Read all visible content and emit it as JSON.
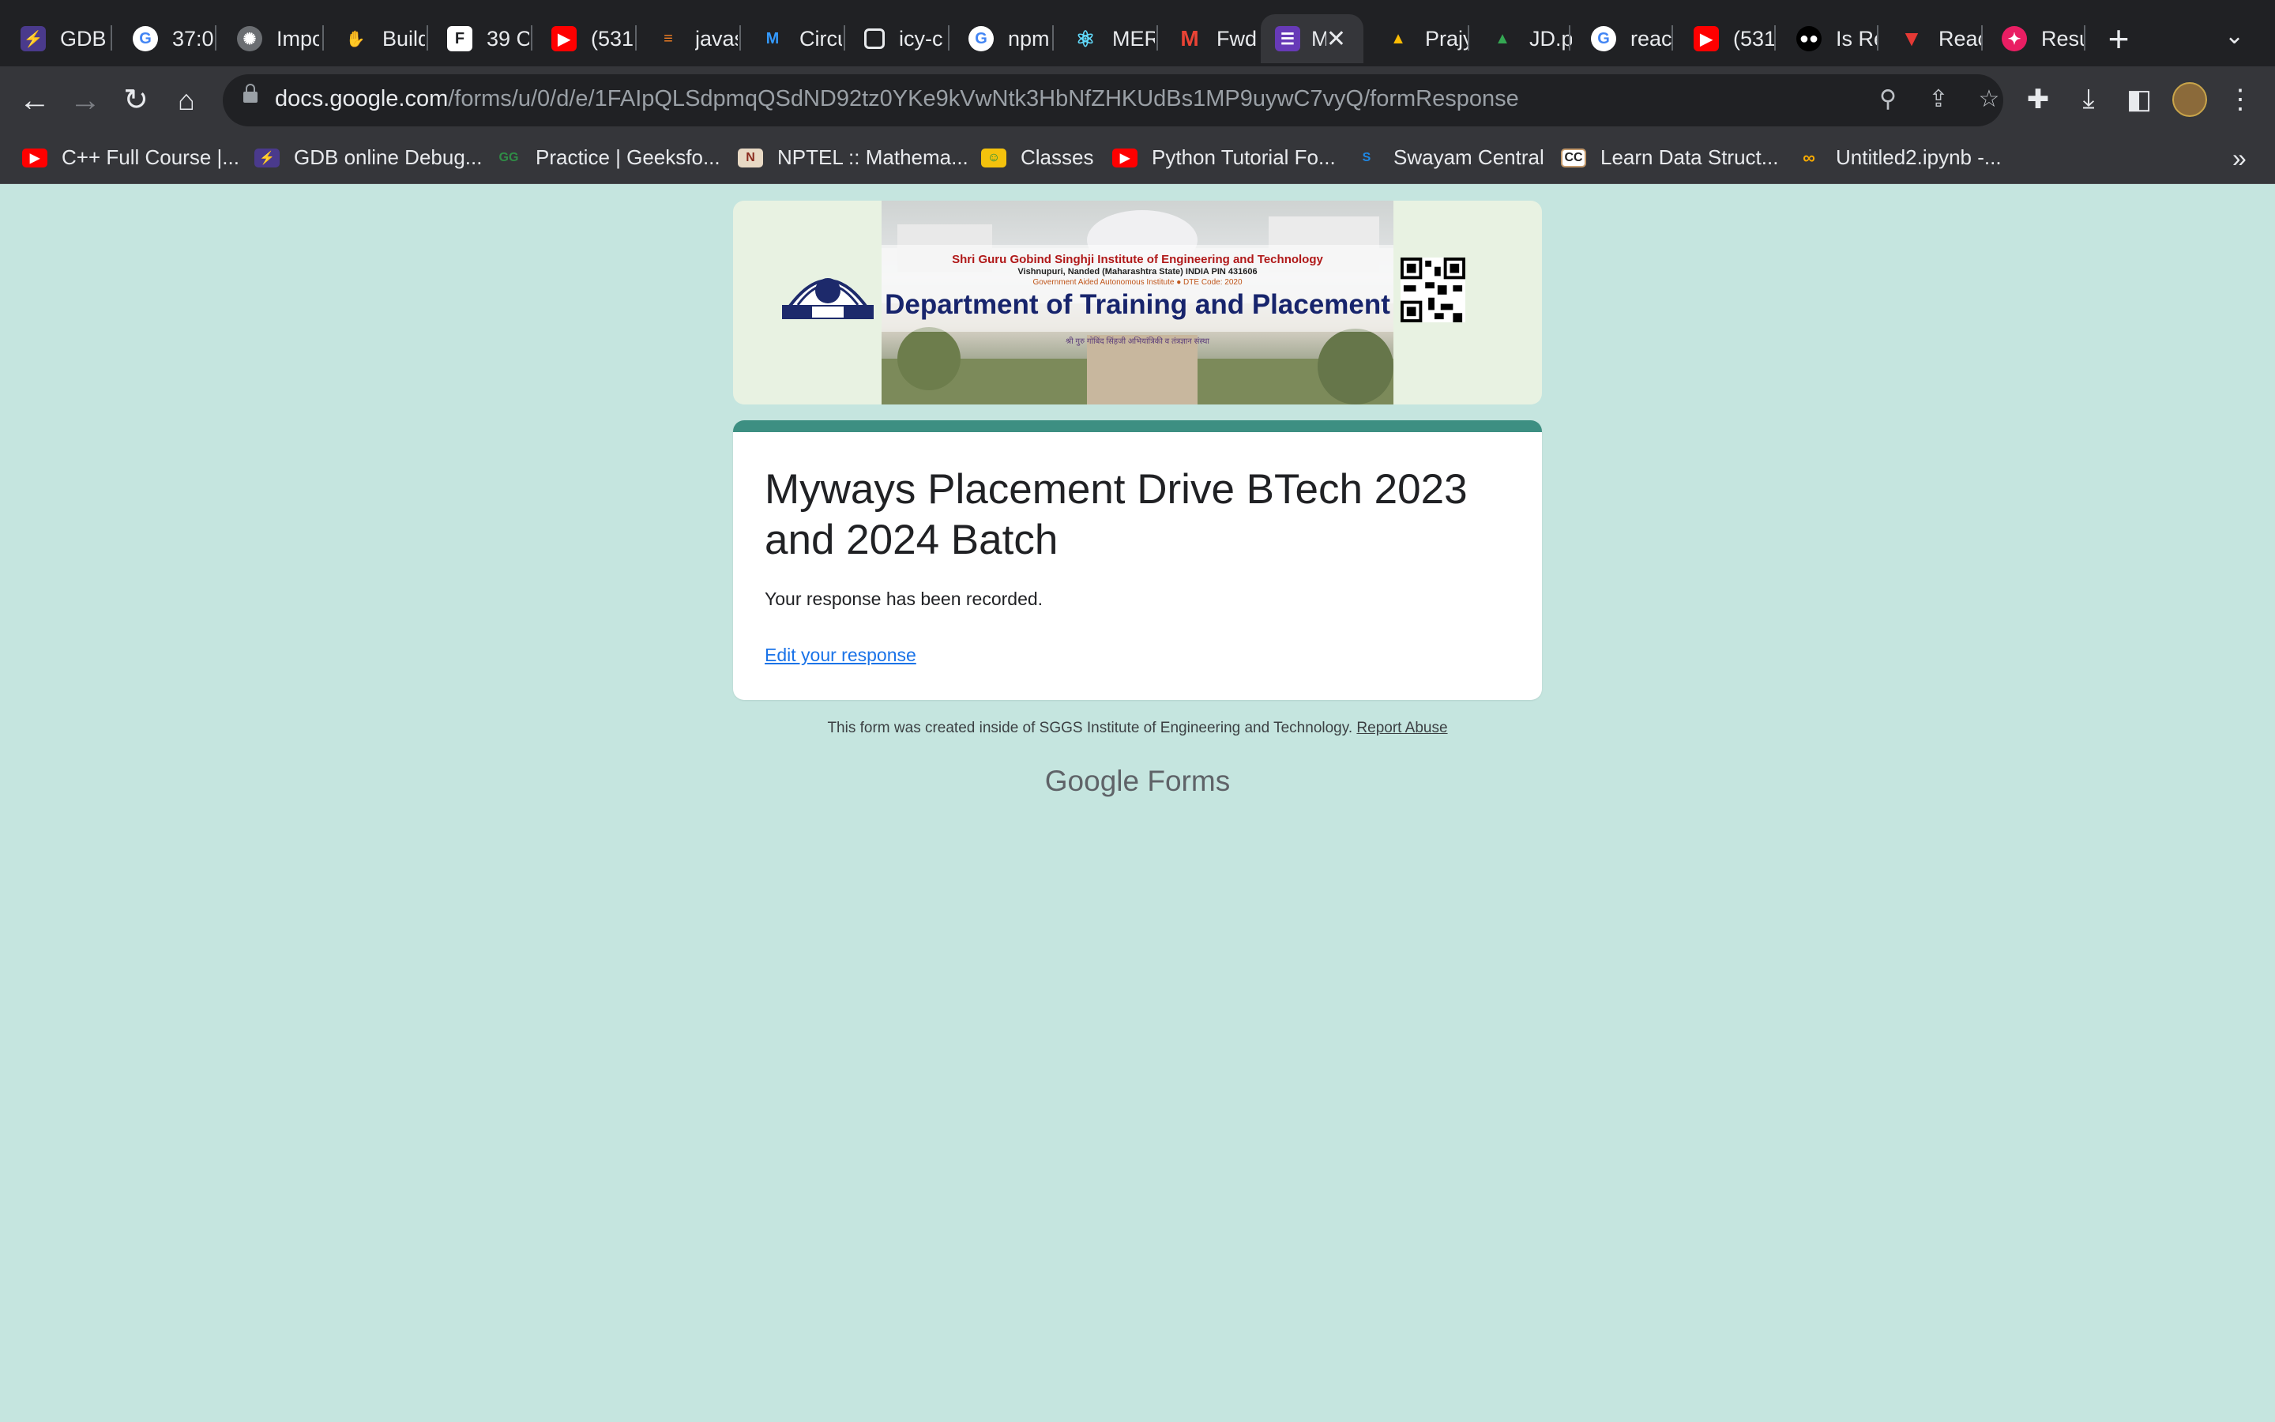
{
  "browser": {
    "tabs": [
      {
        "title": "GDB",
        "icon": "gdb-icon"
      },
      {
        "title": "37:0",
        "icon": "google-icon"
      },
      {
        "title": "Impo",
        "icon": "chatgpt-icon"
      },
      {
        "title": "Build",
        "icon": "hand-icon"
      },
      {
        "title": "39 C",
        "icon": "f-icon"
      },
      {
        "title": "(531",
        "icon": "youtube-icon"
      },
      {
        "title": "javas",
        "icon": "stackoverflow-icon"
      },
      {
        "title": "Circu",
        "icon": "mui-icon"
      },
      {
        "title": "icy-c",
        "icon": "square-icon"
      },
      {
        "title": "npm",
        "icon": "google-icon"
      },
      {
        "title": "MER",
        "icon": "react-icon"
      },
      {
        "title": "Fwd",
        "icon": "gmail-icon"
      },
      {
        "title": "M",
        "icon": "forms-icon",
        "active": true
      },
      {
        "title": "Prajy",
        "icon": "drive-icon"
      },
      {
        "title": "JD.p",
        "icon": "drive-icon"
      },
      {
        "title": "reac",
        "icon": "google-icon"
      },
      {
        "title": "(531",
        "icon": "youtube-icon"
      },
      {
        "title": "Is Re",
        "icon": "medium-icon"
      },
      {
        "title": "Reac",
        "icon": "vercel-red-icon"
      },
      {
        "title": "Resu",
        "icon": "resume-icon"
      }
    ],
    "url_host": "docs.google.com",
    "url_path": "/forms/u/0/d/e/1FAIpQLSdpmqQSdND92tz0YKe9kVwNtk3HbNfZHKUdBs1MP9uywC7vyQ/formResponse",
    "bookmarks": [
      {
        "label": "C++ Full Course |...",
        "icon": "youtube-icon"
      },
      {
        "label": "GDB online Debug...",
        "icon": "gdb-icon"
      },
      {
        "label": "Practice | Geeksfo...",
        "icon": "gfg-icon"
      },
      {
        "label": "NPTEL :: Mathema...",
        "icon": "nptel-icon"
      },
      {
        "label": "Classes",
        "icon": "classroom-icon"
      },
      {
        "label": "Python Tutorial Fo...",
        "icon": "youtube-icon"
      },
      {
        "label": "Swayam Central",
        "icon": "swayam-icon"
      },
      {
        "label": "Learn Data Struct...",
        "icon": "cc-icon"
      },
      {
        "label": "Untitled2.ipynb -...",
        "icon": "colab-icon"
      }
    ],
    "bookmarks_more": "»"
  },
  "banner": {
    "institute": "Shri Guru Gobind Singhji Institute of Engineering and Technology",
    "address": "Vishnupuri, Nanded (Maharashtra State) INDIA PIN 431606",
    "govt": "Government Aided Autonomous Institute ● DTE Code: 2020",
    "department": "Department of Training and Placement",
    "hindi": "श्री गुरु गोबिंद सिंहजी अभियांत्रिकी व तंत्रज्ञान संस्था"
  },
  "form": {
    "title": "Myways Placement Drive BTech 2023 and 2024 Batch",
    "confirmation": "Your response has been recorded.",
    "edit_link": "Edit your response"
  },
  "footer": {
    "note": "This form was created inside of SGGS Institute of Engineering and Technology.",
    "report_abuse": "Report Abuse",
    "brand_google": "Google",
    "brand_forms": "Forms"
  },
  "colors": {
    "page_bg": "#c5e5df",
    "card_accent": "#3d8f82",
    "link": "#1a73e8"
  }
}
